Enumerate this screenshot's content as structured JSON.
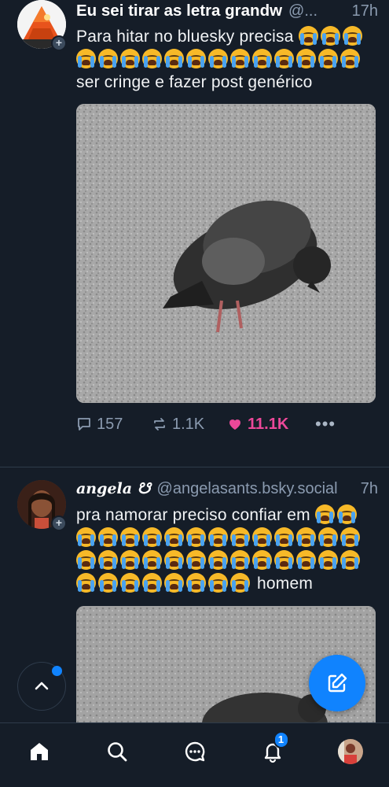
{
  "posts": [
    {
      "author_name": "Eu sei tirar as letra grandw",
      "handle": "@...",
      "time": "17h",
      "text_before": "Para hitar no bluesky precisa ",
      "emoji_count": 16,
      "text_after": " ser cringe e fazer post genérico",
      "emoji_name": "loudly-crying-face",
      "reply_count": "157",
      "repost_count": "1.1K",
      "like_count": "11.1K",
      "more_label": "•••"
    },
    {
      "author_name": "angela ☋",
      "handle": "@angelasants.bsky.social",
      "time": "7h",
      "text_before": "pra namorar preciso confiar em ",
      "emoji_count": 36,
      "text_after": " homem",
      "emoji_name": "loudly-crying-face"
    }
  ],
  "tabbar": {
    "items": [
      "home",
      "search",
      "chat",
      "notifications",
      "profile"
    ],
    "notification_badge": "1"
  },
  "colors": {
    "background": "#151d28",
    "accent": "#1083fe",
    "like": "#ec4899",
    "muted": "#8b9bb0"
  }
}
